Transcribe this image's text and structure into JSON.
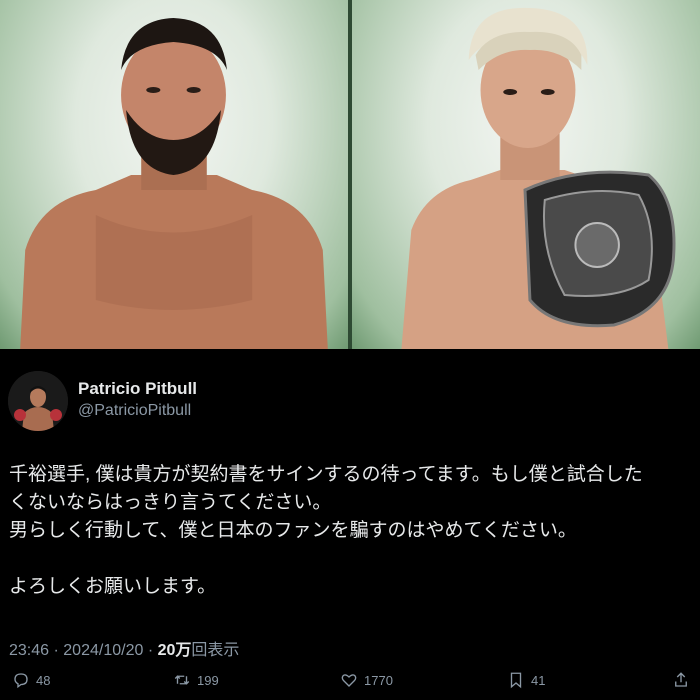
{
  "media": {
    "left_alt_icon": "fighter-portrait",
    "right_alt_icon": "fighter-with-belt-portrait"
  },
  "tweet": {
    "display_name": "Patricio Pitbull",
    "handle": "@PatricioPitbull",
    "text_lines": [
      "千裕選手, 僕は貴方が契約書をサインするの待ってます。もし僕と試合した",
      "くないならはっきり言うてください。",
      "男らしく行動して、僕と日本のファンを騙すのはやめてください。",
      "",
      "よろしくお願いします。"
    ],
    "time": "23:46",
    "separator": "·",
    "date": "2024/10/20",
    "views_count": "20万",
    "views_label": "回表示"
  },
  "actions": {
    "replies": "48",
    "retweets": "199",
    "likes": "1770",
    "bookmarks": "41"
  },
  "colors": {
    "background": "#000000",
    "text": "#e7e9ea",
    "muted": "#8b98a5",
    "poster_green": "#6f9a72"
  }
}
